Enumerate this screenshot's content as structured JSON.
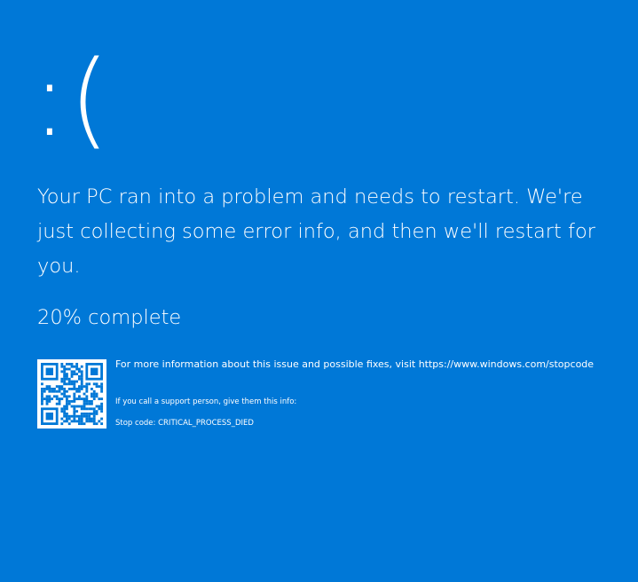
{
  "screen": {
    "background_color": "#0078D7",
    "text_color": "#FFFFFF",
    "sad_face": ":(",
    "message": "Your PC ran into a problem and needs to restart. We're just collecting some error info, and then we'll restart for you.",
    "progress_text": "20% complete",
    "progress_percent": 20,
    "more_info": "For more information about this issue and possible fixes, visit https://www.windows.com/stopcode",
    "support_text": "If you call a support person, give them this info:",
    "stop_code": "Stop code: CRITICAL_PROCESS_DIED",
    "qr_icon": "qr-code-icon"
  }
}
